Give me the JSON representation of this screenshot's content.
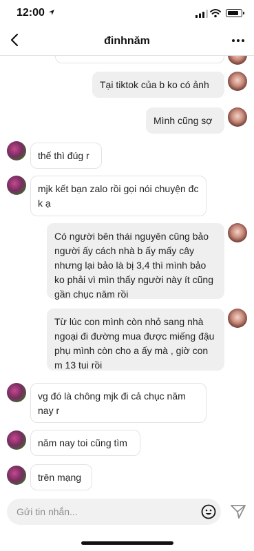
{
  "status": {
    "time": "12:00",
    "battery_level": 0.85
  },
  "header": {
    "title": "đinhnăm"
  },
  "messages": [
    {
      "side": "sent",
      "text": ""
    },
    {
      "side": "sent",
      "text": "Tại tiktok của b ko có ảnh"
    },
    {
      "side": "sent",
      "text": "Mình cũng sợ"
    },
    {
      "side": "received",
      "text": "thế thì đúg r"
    },
    {
      "side": "received",
      "text": "mjk kết bạn zalo rồi gọi nói chuyện đc k ạ"
    },
    {
      "side": "sent",
      "text": "Có người bên thái nguyên cũng bảo người ấy cách nhà b ấy mấy cây nhưng lại bảo là bị 3,4 thì mình bảo ko phải vì mìn thấy người này ít cũng gần chục năm rồi"
    },
    {
      "side": "sent",
      "text": "Từ lúc con mình còn nhỏ sang nhà ngoại đi đường mua được miếng đậu phụ mình còn cho a ấy mà , giờ con m 13 tui rồi"
    },
    {
      "side": "received",
      "text": "vg đó là chông mjk đi cả chục năm nay r"
    },
    {
      "side": "received",
      "text": "năm nay toi cũng tìm"
    },
    {
      "side": "received",
      "text": "trên mạng"
    }
  ],
  "composer": {
    "placeholder": "Gửi tin nhắn...",
    "value": ""
  }
}
